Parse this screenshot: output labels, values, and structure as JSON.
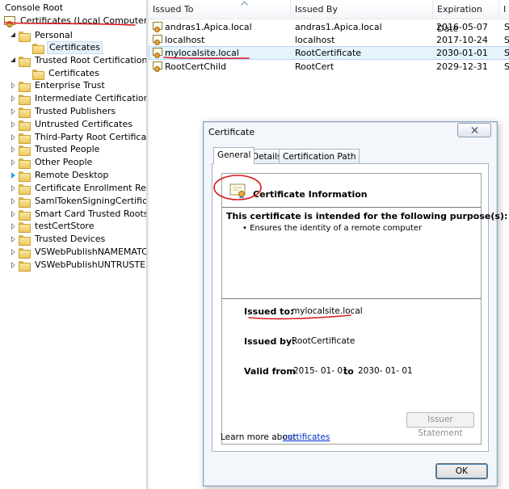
{
  "tree": {
    "root": "Console Root",
    "store": "Certificates (Local Computer)",
    "items": [
      {
        "label": "Personal"
      },
      {
        "label": "Certificates"
      },
      {
        "label": "Trusted Root Certification Aut"
      },
      {
        "label": "Certificates"
      },
      {
        "label": "Enterprise Trust"
      },
      {
        "label": "Intermediate Certification Aut"
      },
      {
        "label": "Trusted Publishers"
      },
      {
        "label": "Untrusted Certificates"
      },
      {
        "label": "Third-Party Root Certification"
      },
      {
        "label": "Trusted People"
      },
      {
        "label": "Other People"
      },
      {
        "label": "Remote Desktop"
      },
      {
        "label": "Certificate Enrollment Reques"
      },
      {
        "label": "SamlTokenSigningCertificate!"
      },
      {
        "label": "Smart Card Trusted Roots"
      },
      {
        "label": "testCertStore"
      },
      {
        "label": "Trusted Devices"
      },
      {
        "label": "VSWebPublishNAMEMATCH("
      },
      {
        "label": "VSWebPublishUNTRUSTEDRO"
      }
    ]
  },
  "list": {
    "columns": [
      "Issued To",
      "Issued By",
      "Expiration Date",
      "I"
    ],
    "rows": [
      {
        "issued_to": "andras1.Apica.local",
        "issued_by": "andras1.Apica.local",
        "expires": "2016-05-07",
        "extra": "S"
      },
      {
        "issued_to": "localhost",
        "issued_by": "localhost",
        "expires": "2017-10-24",
        "extra": "S"
      },
      {
        "issued_to": "mylocalsite.local",
        "issued_by": "RootCertificate",
        "expires": "2030-01-01",
        "extra": "S"
      },
      {
        "issued_to": "RootCertChild",
        "issued_by": "RootCert",
        "expires": "2029-12-31",
        "extra": "S"
      }
    ]
  },
  "dialog": {
    "title": "Certificate",
    "tabs": [
      "General",
      "Details",
      "Certification Path"
    ],
    "heading": "Certificate Information",
    "purpose_heading": "This certificate is intended for the following purpose(s):",
    "purpose_item": "• Ensures the identity of a remote computer",
    "issued_to_label": "Issued to:",
    "issued_to_value": "mylocalsite.local",
    "issued_by_label": "Issued by:",
    "issued_by_value": "RootCertificate",
    "valid_from_label": "Valid from",
    "valid_from_value": "2015- 01- 01",
    "valid_to_label": "to",
    "valid_to_value": "2030- 01- 01",
    "issuer_statement_button": "Issuer Statement",
    "learn_more_text": "Learn more about",
    "learn_more_link": "certificates",
    "ok_button": "OK"
  },
  "colors": {
    "annotation_red": "#d71920",
    "link_blue": "#0033cc",
    "selection_blue": "#e5f3fb"
  }
}
